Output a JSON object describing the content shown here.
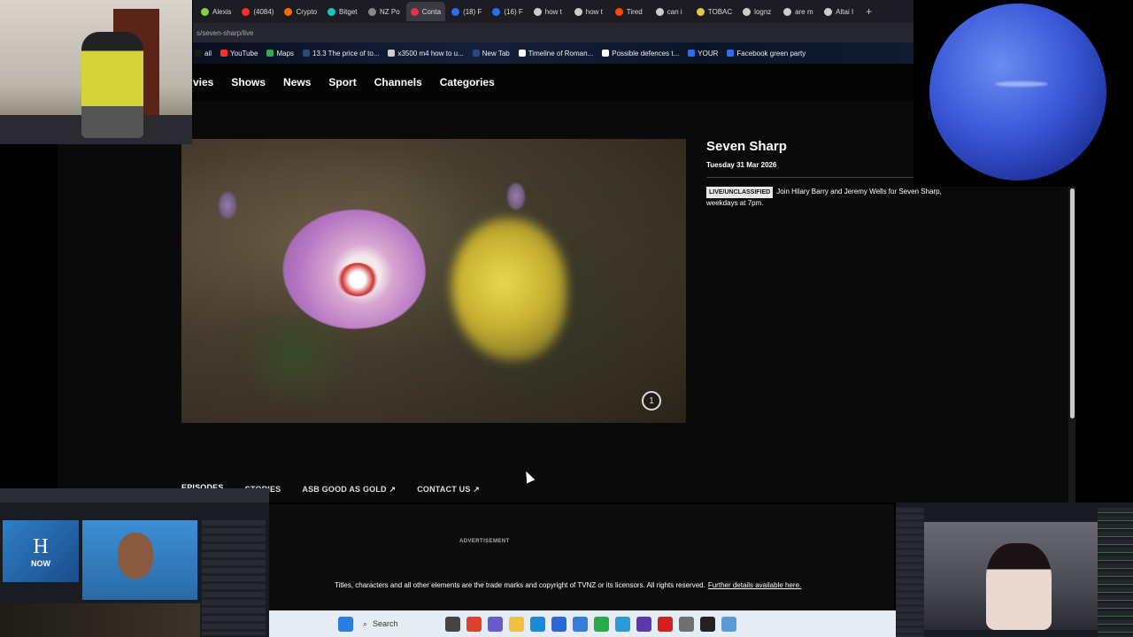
{
  "browser": {
    "tabs": [
      {
        "label": "Alexis",
        "color": "#7fd34a"
      },
      {
        "label": "(4084)",
        "color": "#ff2d2d"
      },
      {
        "label": "Crypto",
        "color": "#ff6a00"
      },
      {
        "label": "Bitget",
        "color": "#16c4c4"
      },
      {
        "label": "NZ Po",
        "color": "#888888"
      },
      {
        "label": "Conta",
        "color": "#e2334a"
      },
      {
        "label": "(18) F",
        "color": "#2d6cf0"
      },
      {
        "label": "(16) F",
        "color": "#2d6cf0"
      },
      {
        "label": "how t",
        "color": "#cccccc"
      },
      {
        "label": "how t",
        "color": "#cccccc"
      },
      {
        "label": "Tired",
        "color": "#ff4500"
      },
      {
        "label": "can i",
        "color": "#cccccc"
      },
      {
        "label": "TOBAC",
        "color": "#e8c44a"
      },
      {
        "label": "lognz",
        "color": "#cccccc"
      },
      {
        "label": "are m",
        "color": "#cccccc"
      },
      {
        "label": "Altai I",
        "color": "#cccccc"
      }
    ],
    "active_tab_index": 5,
    "new_tab_label": "+",
    "url": "s/seven-sharp/live",
    "bookmarks": [
      {
        "label": "ail",
        "color": "#1a1a1a"
      },
      {
        "label": "YouTube",
        "color": "#ff2d2d"
      },
      {
        "label": "Maps",
        "color": "#34a853"
      },
      {
        "label": "13.3 The price of to...",
        "color": "#2a4a7a"
      },
      {
        "label": "x3500 m4 how to u...",
        "color": "#cccccc"
      },
      {
        "label": "New Tab",
        "color": "#2a4a7a"
      },
      {
        "label": "Timeline of Roman...",
        "color": "#ffffff"
      },
      {
        "label": "Possible defences t...",
        "color": "#ffffff"
      },
      {
        "label": "YOUR",
        "color": "#2d6cf0"
      },
      {
        "label": "Facebook green party",
        "color": "#2d6cf0"
      }
    ]
  },
  "site": {
    "nav": [
      "vies",
      "Shows",
      "News",
      "Sport",
      "Channels",
      "Categories"
    ]
  },
  "episode": {
    "title": "Seven Sharp",
    "date": "Tuesday 31 Mar 2026",
    "badge": "LIVE/UNCLASSIFIED",
    "description": "Join Hilary Barry and Jeremy Wells for Seven Sharp, weekdays at 7pm.",
    "video_badge": "1"
  },
  "page_tabs": [
    {
      "label": "EPISODES",
      "active": true
    },
    {
      "label": "STORIES",
      "active": false
    },
    {
      "label": "ASB GOOD AS GOLD ↗",
      "active": false
    },
    {
      "label": "CONTACT US ↗",
      "active": false
    }
  ],
  "footer": {
    "ad_label": "ADVERTISEMENT",
    "copyright": "Titles, characters and all other elements are the trade marks and copyright of TVNZ or its licensors. All rights reserved.",
    "copyright_link": "Further details available here."
  },
  "taskbar": {
    "search_label": "Search",
    "apps": [
      {
        "name": "windows-start-icon",
        "color": "#2b7de0"
      },
      {
        "name": "file-explorer-icon",
        "color": "#444444"
      },
      {
        "name": "chrome-icon",
        "color": "#e04030"
      },
      {
        "name": "photos-icon",
        "color": "#6a5ad0"
      },
      {
        "name": "folder-icon",
        "color": "#f0c040"
      },
      {
        "name": "edge-icon",
        "color": "#1a8ad8"
      },
      {
        "name": "mail-icon",
        "color": "#2a6ad0"
      },
      {
        "name": "store-icon",
        "color": "#3a7ad8"
      },
      {
        "name": "app-green-icon",
        "color": "#2aa84a"
      },
      {
        "name": "telegram-icon",
        "color": "#2a9ad8"
      },
      {
        "name": "obs-icon",
        "color": "#5a3aa8"
      },
      {
        "name": "red-app-icon",
        "color": "#d02020"
      },
      {
        "name": "settings-icon",
        "color": "#707070"
      },
      {
        "name": "github-icon",
        "color": "#222222"
      },
      {
        "name": "monitor-icon",
        "color": "#5a9ad8"
      }
    ]
  },
  "overlays": {
    "news_logo": "H",
    "news_word": "NOW"
  }
}
